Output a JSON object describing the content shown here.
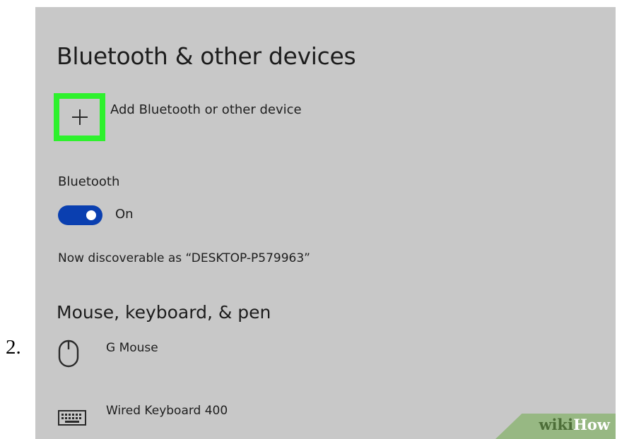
{
  "step_number": "2.",
  "page_title": "Bluetooth & other devices",
  "add_device": {
    "label": "Add Bluetooth or other device",
    "icon": "plus-icon"
  },
  "bluetooth": {
    "heading": "Bluetooth",
    "toggle_state": "On",
    "toggle_color": "#0a3fb0"
  },
  "discoverable_text": "Now discoverable as “DESKTOP-P579963”",
  "section_title": "Mouse, keyboard, & pen",
  "devices": [
    {
      "name": "G Mouse",
      "icon": "mouse-icon"
    },
    {
      "name": "Wired Keyboard 400",
      "icon": "keyboard-icon"
    }
  ],
  "highlight_color": "#2ef12d",
  "watermark": {
    "wiki": "wiki",
    "how": "How"
  }
}
